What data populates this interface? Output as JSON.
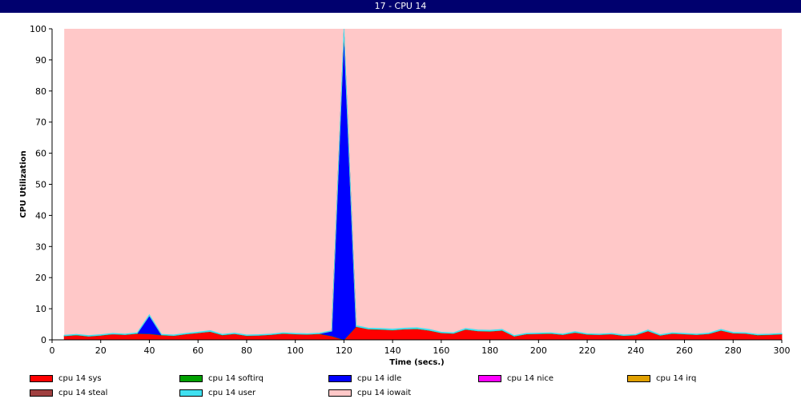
{
  "window": {
    "title": "17 - CPU 14"
  },
  "colors": {
    "sys": "#ff0000",
    "softirq": "#00a000",
    "idle": "#0000ff",
    "nice": "#ff00ff",
    "irq": "#e0a000",
    "steal": "#a04040",
    "user": "#40e0f0",
    "iowait": "#ffc8c8"
  },
  "legend": [
    {
      "key": "sys",
      "label": "cpu 14 sys",
      "color": "#ff0000"
    },
    {
      "key": "softirq",
      "label": "cpu 14 softirq",
      "color": "#00a000"
    },
    {
      "key": "idle",
      "label": "cpu 14 idle",
      "color": "#0000ff"
    },
    {
      "key": "nice",
      "label": "cpu 14 nice",
      "color": "#ff00ff"
    },
    {
      "key": "irq",
      "label": "cpu 14 irq",
      "color": "#e0a000"
    },
    {
      "key": "steal",
      "label": "cpu 14 steal",
      "color": "#a04040"
    },
    {
      "key": "user",
      "label": "cpu 14 user",
      "color": "#40e0f0"
    },
    {
      "key": "iowait",
      "label": "cpu 14 iowait",
      "color": "#ffc8c8"
    }
  ],
  "chart_data": {
    "type": "area",
    "stacked": true,
    "xlabel": "Time (secs.)",
    "ylabel": "CPU Utilization",
    "xlim": [
      0,
      300
    ],
    "ylim": [
      0,
      100
    ],
    "xticks": [
      0,
      20,
      40,
      60,
      80,
      100,
      120,
      140,
      160,
      180,
      200,
      220,
      240,
      260,
      280,
      300
    ],
    "yticks": [
      0,
      10,
      20,
      30,
      40,
      50,
      60,
      70,
      80,
      90,
      100
    ],
    "grid": false,
    "legend_position": "bottom",
    "x": [
      5,
      10,
      15,
      20,
      25,
      30,
      35,
      40,
      45,
      50,
      55,
      60,
      65,
      70,
      75,
      80,
      85,
      90,
      95,
      100,
      105,
      110,
      115,
      120,
      125,
      130,
      135,
      140,
      145,
      150,
      155,
      160,
      165,
      170,
      175,
      180,
      185,
      190,
      195,
      200,
      205,
      210,
      215,
      220,
      225,
      230,
      235,
      240,
      245,
      250,
      255,
      260,
      265,
      270,
      275,
      280,
      285,
      290,
      295,
      300
    ],
    "series": [
      {
        "name": "cpu 14 sys",
        "key": "sys",
        "values": [
          1.2,
          1.5,
          1.1,
          1.4,
          1.8,
          1.6,
          2.0,
          1.9,
          1.5,
          1.3,
          1.8,
          2.2,
          2.6,
          1.5,
          1.9,
          1.3,
          1.4,
          1.6,
          2.0,
          1.8,
          1.7,
          1.9,
          1.2,
          0.0,
          4.2,
          3.4,
          3.3,
          3.1,
          3.4,
          3.5,
          3.0,
          2.2,
          2.0,
          3.3,
          2.8,
          2.7,
          3.0,
          1.1,
          1.8,
          1.9,
          2.0,
          1.6,
          2.3,
          1.7,
          1.6,
          1.8,
          1.3,
          1.5,
          2.8,
          1.4,
          2.0,
          1.8,
          1.6,
          1.9,
          3.0,
          2.1,
          2.0,
          1.5,
          1.6,
          1.8
        ]
      },
      {
        "name": "cpu 14 softirq",
        "key": "softirq",
        "values": [
          0.1,
          0.1,
          0.1,
          0.1,
          0.1,
          0.1,
          0.1,
          0.1,
          0.1,
          0.1,
          0.1,
          0.1,
          0.1,
          0.1,
          0.1,
          0.1,
          0.1,
          0.1,
          0.1,
          0.1,
          0.1,
          0.1,
          0.1,
          0.1,
          0.1,
          0.1,
          0.1,
          0.1,
          0.1,
          0.1,
          0.1,
          0.1,
          0.1,
          0.1,
          0.1,
          0.1,
          0.1,
          0.1,
          0.1,
          0.1,
          0.1,
          0.1,
          0.1,
          0.1,
          0.1,
          0.1,
          0.1,
          0.1,
          0.1,
          0.1,
          0.1,
          0.1,
          0.1,
          0.1,
          0.1,
          0.1,
          0.1,
          0.1,
          0.1,
          0.1
        ]
      },
      {
        "name": "cpu 14 idle",
        "key": "idle",
        "values": [
          0,
          0,
          0,
          0,
          0,
          0,
          0,
          5.8,
          0,
          0,
          0,
          0,
          0,
          0,
          0,
          0,
          0,
          0,
          0,
          0,
          0,
          0,
          1.5,
          98.8,
          0,
          0,
          0,
          0,
          0,
          0,
          0,
          0,
          0,
          0,
          0,
          0,
          0,
          0,
          0,
          0,
          0,
          0,
          0,
          0,
          0,
          0,
          0,
          0,
          0,
          0,
          0,
          0,
          0,
          0,
          0,
          0,
          0,
          0,
          0,
          0
        ]
      },
      {
        "name": "cpu 14 nice",
        "key": "nice",
        "values": [
          0,
          0,
          0,
          0,
          0,
          0,
          0,
          0,
          0,
          0,
          0,
          0,
          0,
          0,
          0,
          0,
          0,
          0,
          0,
          0,
          0,
          0,
          0,
          0,
          0,
          0,
          0,
          0,
          0,
          0,
          0,
          0,
          0,
          0,
          0,
          0,
          0,
          0,
          0,
          0,
          0,
          0,
          0,
          0,
          0,
          0,
          0,
          0,
          0,
          0,
          0,
          0,
          0,
          0,
          0,
          0,
          0,
          0,
          0,
          0
        ]
      },
      {
        "name": "cpu 14 irq",
        "key": "irq",
        "values": [
          0,
          0,
          0,
          0,
          0,
          0,
          0,
          0,
          0,
          0,
          0,
          0,
          0,
          0,
          0,
          0,
          0,
          0,
          0,
          0,
          0,
          0,
          0,
          0,
          0,
          0,
          0,
          0,
          0,
          0,
          0,
          0,
          0,
          0,
          0,
          0,
          0,
          0,
          0,
          0,
          0,
          0,
          0,
          0,
          0,
          0,
          0,
          0,
          0,
          0,
          0,
          0,
          0,
          0,
          0,
          0,
          0,
          0,
          0,
          0
        ]
      },
      {
        "name": "cpu 14 steal",
        "key": "steal",
        "values": [
          0,
          0,
          0,
          0,
          0,
          0,
          0,
          0,
          0,
          0,
          0,
          0,
          0,
          0,
          0,
          0,
          0,
          0,
          0,
          0,
          0,
          0,
          0,
          0,
          0,
          0,
          0,
          0,
          0,
          0,
          0,
          0,
          0,
          0,
          0,
          0,
          0,
          0,
          0,
          0,
          0,
          0,
          0,
          0,
          0,
          0,
          0,
          0,
          0,
          0,
          0,
          0,
          0,
          0,
          0,
          0,
          0,
          0,
          0,
          0
        ]
      },
      {
        "name": "cpu 14 user",
        "key": "user",
        "values": [
          0.2,
          0.2,
          0.2,
          0.2,
          0.2,
          0.2,
          0.2,
          0.3,
          0.2,
          0.2,
          0.2,
          0.2,
          0.3,
          0.2,
          0.2,
          0.2,
          0.2,
          0.2,
          0.2,
          0.2,
          0.2,
          0.2,
          0.2,
          1.1,
          0.3,
          0.3,
          0.3,
          0.3,
          0.3,
          0.3,
          0.3,
          0.2,
          0.2,
          0.3,
          0.3,
          0.3,
          0.3,
          0.2,
          0.2,
          0.2,
          0.2,
          0.2,
          0.3,
          0.2,
          0.2,
          0.2,
          0.2,
          0.2,
          0.3,
          0.2,
          0.2,
          0.2,
          0.2,
          0.2,
          0.3,
          0.2,
          0.2,
          0.2,
          0.2,
          0.2
        ]
      },
      {
        "name": "cpu 14 iowait",
        "key": "iowait",
        "fill_remainder": true
      }
    ]
  }
}
